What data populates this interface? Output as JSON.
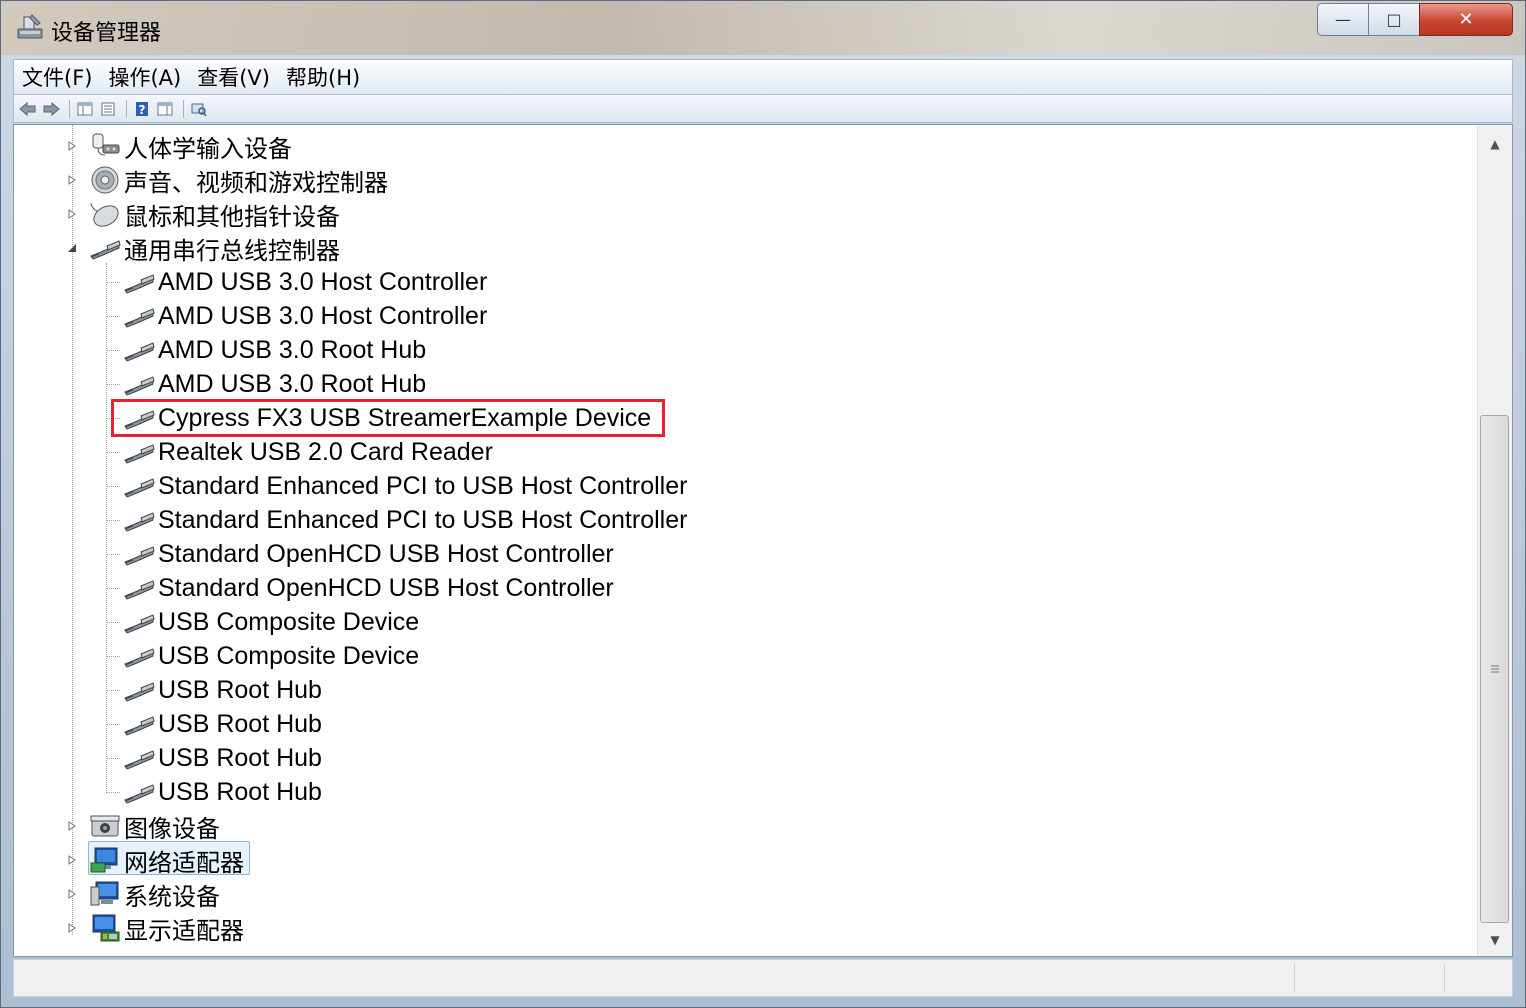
{
  "window": {
    "title": "设备管理器",
    "controls": {
      "minimize": "—",
      "maximize": "□",
      "close": "✕"
    }
  },
  "menu": [
    "文件(F)",
    "操作(A)",
    "查看(V)",
    "帮助(H)"
  ],
  "toolbar": [
    "back-icon",
    "forward-icon",
    "show-hide-tree-icon",
    "properties-icon",
    "help-icon",
    "action-pane-icon",
    "scan-hardware-icon"
  ],
  "tree": {
    "categories_before": [
      {
        "label": "人体学输入设备",
        "icon": "hid-icon",
        "expanded": false
      },
      {
        "label": "声音、视频和游戏控制器",
        "icon": "speaker-icon",
        "expanded": false
      },
      {
        "label": "鼠标和其他指针设备",
        "icon": "mouse-icon",
        "expanded": false
      }
    ],
    "usb_category": {
      "label": "通用串行总线控制器",
      "icon": "usb-icon",
      "expanded": true,
      "children": [
        "AMD USB 3.0 Host Controller",
        "AMD USB 3.0 Host Controller",
        "AMD USB 3.0 Root Hub",
        "AMD USB 3.0 Root Hub",
        "Cypress FX3 USB StreamerExample Device",
        "Realtek USB 2.0 Card Reader",
        "Standard Enhanced PCI to USB Host Controller",
        "Standard Enhanced PCI to USB Host Controller",
        "Standard OpenHCD USB Host Controller",
        "Standard OpenHCD USB Host Controller",
        "USB Composite Device",
        "USB Composite Device",
        "USB Root Hub",
        "USB Root Hub",
        "USB Root Hub",
        "USB Root Hub"
      ],
      "highlighted_child": "Cypress FX3 USB StreamerExample Device"
    },
    "categories_after": [
      {
        "label": "图像设备",
        "icon": "camera-icon",
        "expanded": false
      },
      {
        "label": "网络适配器",
        "icon": "network-adapter-icon",
        "expanded": false,
        "selected": true
      },
      {
        "label": "系统设备",
        "icon": "system-devices-icon",
        "expanded": false
      },
      {
        "label": "显示适配器",
        "icon": "display-adapter-icon",
        "expanded": false
      }
    ]
  },
  "colors": {
    "highlight_border": "#e8232f",
    "selection_bg": "#e5f1fb",
    "close_button": "#c74632"
  }
}
